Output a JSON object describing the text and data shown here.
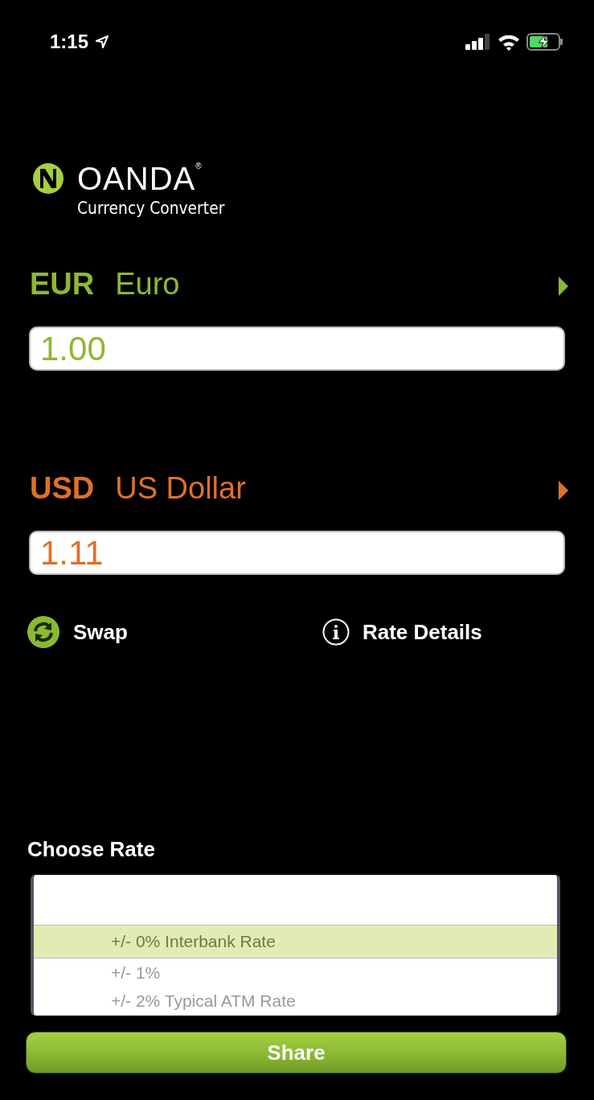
{
  "status_bar": {
    "time": "1:15"
  },
  "logo": {
    "brand": "OANDA",
    "mark": "®",
    "subtitle": "Currency Converter"
  },
  "currencies": [
    {
      "code": "EUR",
      "name": "Euro",
      "amount": "1.00",
      "color": "#8db833"
    },
    {
      "code": "USD",
      "name": "US Dollar",
      "amount": "1.11",
      "color": "#e0702a"
    }
  ],
  "actions": [
    {
      "kind": "swap",
      "label": "Swap"
    },
    {
      "kind": "info",
      "label": "Rate Details"
    }
  ],
  "rate_picker": {
    "title": "Choose Rate",
    "options": [
      {
        "label": "+/- 0% Interbank Rate",
        "selected": true
      },
      {
        "label": "+/- 1%",
        "selected": false
      },
      {
        "label": "+/- 2% Typical ATM Rate",
        "selected": false
      }
    ]
  },
  "share_button": {
    "label": "Share"
  }
}
